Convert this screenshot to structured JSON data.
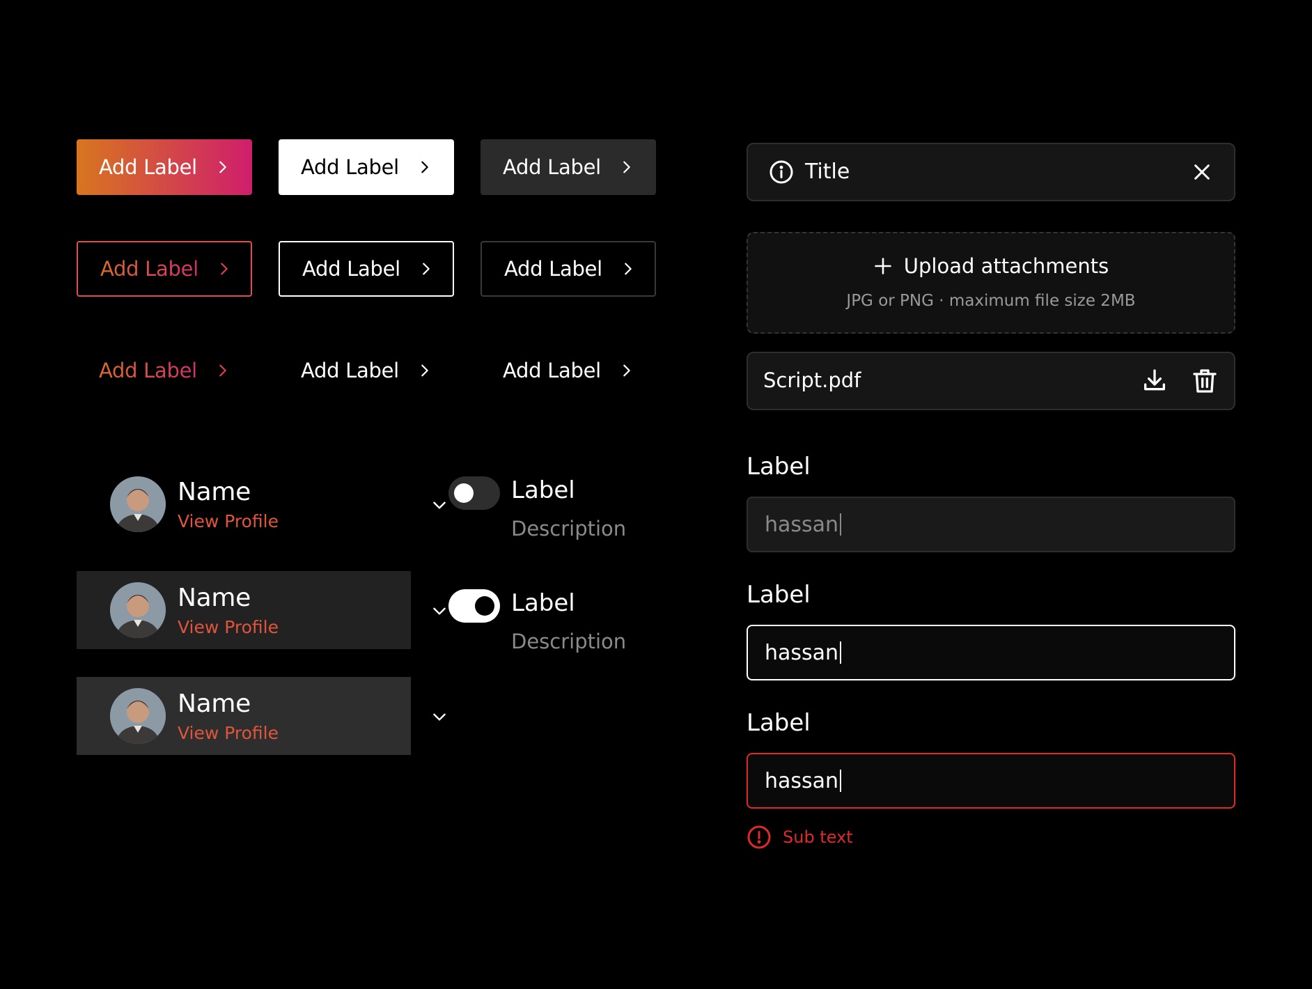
{
  "buttons": {
    "label": "Add Label",
    "rows": [
      [
        "gradient",
        "white",
        "gray"
      ],
      [
        "outline-gradient",
        "outline-white",
        "outline-gray"
      ],
      [
        "text-gradient",
        "text-white",
        "text-white"
      ]
    ]
  },
  "profiles": [
    {
      "name": "Name",
      "link": "View Profile"
    },
    {
      "name": "Name",
      "link": "View Profile"
    },
    {
      "name": "Name",
      "link": "View Profile"
    }
  ],
  "toggles": [
    {
      "label": "Label",
      "description": "Description",
      "state": "off"
    },
    {
      "label": "Label",
      "description": "Description",
      "state": "on"
    }
  ],
  "alert": {
    "title": "Title"
  },
  "upload": {
    "title": "Upload attachments",
    "subtitle": "JPG or PNG · maximum file size 2MB"
  },
  "file": {
    "name": "Script.pdf"
  },
  "fields": [
    {
      "label": "Label",
      "value": "hassan",
      "state": "default"
    },
    {
      "label": "Label",
      "value": "hassan",
      "state": "focus"
    },
    {
      "label": "Label",
      "value": "hassan",
      "state": "error"
    }
  ],
  "error": {
    "subtext": "Sub text"
  },
  "colors": {
    "background": "#000000",
    "gradient_start": "#D7761F",
    "gradient_end": "#CF1E6C",
    "link": "#E0553C",
    "error": "#E02A2A"
  },
  "icons": {
    "chevron": "chevron-right-icon",
    "dropdown": "chevron-down-icon",
    "info": "info-icon",
    "close": "close-icon",
    "plus": "plus-icon",
    "download": "download-icon",
    "trash": "trash-icon"
  }
}
